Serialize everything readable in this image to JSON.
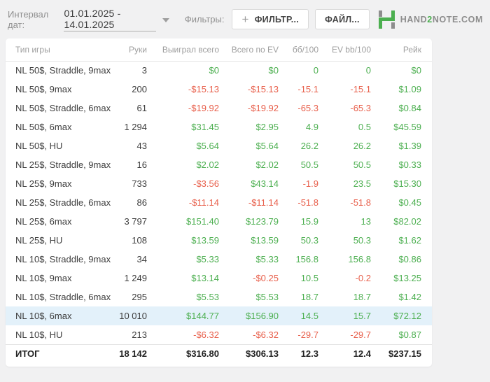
{
  "toolbar": {
    "date_label": "Интервал дат:",
    "date_range": "01.01.2025 - 14.01.2025",
    "filters_label": "Фильтры:",
    "filter_button": "ФИЛЬТР...",
    "file_button": "ФАЙЛ...",
    "logo_part1": "HAND",
    "logo_part2": "2",
    "logo_part3": "NOTE.COM"
  },
  "colors": {
    "positive": "#4caf50",
    "negative": "#e8604c",
    "highlight_row": "#e3f1fa",
    "logo_green": "#4caf50",
    "logo_gray": "#8d8d8d"
  },
  "table": {
    "columns": [
      "Тип игры",
      "Руки",
      "Выиграл всего",
      "Всего по EV",
      "бб/100",
      "EV bb/100",
      "Рейк"
    ],
    "rows": [
      {
        "type": "NL 50$, Straddle, 9max",
        "hands": "3",
        "values": [
          "$0",
          "$0",
          "0",
          "0",
          "$0"
        ]
      },
      {
        "type": "NL 50$, 9max",
        "hands": "200",
        "values": [
          "-$15.13",
          "-$15.13",
          "-15.1",
          "-15.1",
          "$1.09"
        ]
      },
      {
        "type": "NL 50$, Straddle, 6max",
        "hands": "61",
        "values": [
          "-$19.92",
          "-$19.92",
          "-65.3",
          "-65.3",
          "$0.84"
        ]
      },
      {
        "type": "NL 50$, 6max",
        "hands": "1 294",
        "values": [
          "$31.45",
          "$2.95",
          "4.9",
          "0.5",
          "$45.59"
        ]
      },
      {
        "type": "NL 50$, HU",
        "hands": "43",
        "values": [
          "$5.64",
          "$5.64",
          "26.2",
          "26.2",
          "$1.39"
        ]
      },
      {
        "type": "NL 25$, Straddle, 9max",
        "hands": "16",
        "values": [
          "$2.02",
          "$2.02",
          "50.5",
          "50.5",
          "$0.33"
        ]
      },
      {
        "type": "NL 25$, 9max",
        "hands": "733",
        "values": [
          "-$3.56",
          "$43.14",
          "-1.9",
          "23.5",
          "$15.30"
        ]
      },
      {
        "type": "NL 25$, Straddle, 6max",
        "hands": "86",
        "values": [
          "-$11.14",
          "-$11.14",
          "-51.8",
          "-51.8",
          "$0.45"
        ]
      },
      {
        "type": "NL 25$, 6max",
        "hands": "3 797",
        "values": [
          "$151.40",
          "$123.79",
          "15.9",
          "13",
          "$82.02"
        ]
      },
      {
        "type": "NL 25$, HU",
        "hands": "108",
        "values": [
          "$13.59",
          "$13.59",
          "50.3",
          "50.3",
          "$1.62"
        ]
      },
      {
        "type": "NL 10$, Straddle, 9max",
        "hands": "34",
        "values": [
          "$5.33",
          "$5.33",
          "156.8",
          "156.8",
          "$0.86"
        ]
      },
      {
        "type": "NL 10$, 9max",
        "hands": "1 249",
        "values": [
          "$13.14",
          "-$0.25",
          "10.5",
          "-0.2",
          "$13.25"
        ]
      },
      {
        "type": "NL 10$, Straddle, 6max",
        "hands": "295",
        "values": [
          "$5.53",
          "$5.53",
          "18.7",
          "18.7",
          "$1.42"
        ]
      },
      {
        "type": "NL 10$, 6max",
        "hands": "10 010",
        "values": [
          "$144.77",
          "$156.90",
          "14.5",
          "15.7",
          "$72.12"
        ],
        "highlighted": true
      },
      {
        "type": "NL 10$, HU",
        "hands": "213",
        "values": [
          "-$6.32",
          "-$6.32",
          "-29.7",
          "-29.7",
          "$0.87"
        ]
      },
      {
        "type": "ИТОГ",
        "hands": "18 142",
        "values": [
          "$316.80",
          "$306.13",
          "12.3",
          "12.4",
          "$237.15"
        ],
        "total": true
      }
    ]
  }
}
